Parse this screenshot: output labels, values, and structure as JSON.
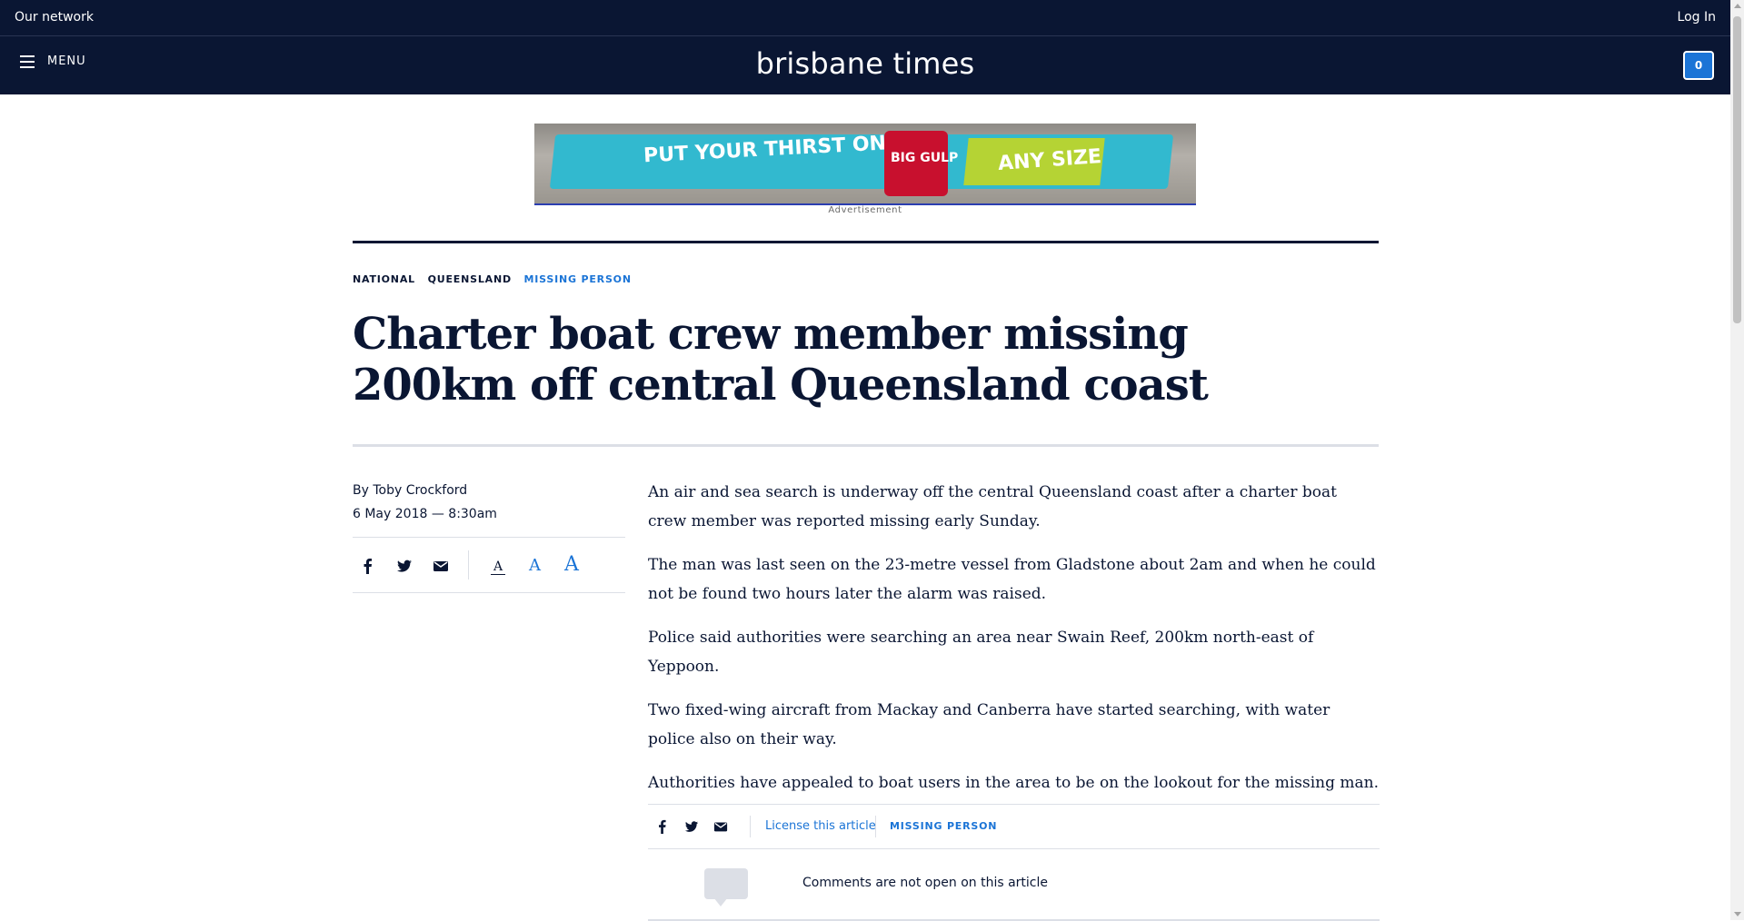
{
  "topbar": {
    "network_label": "Our network",
    "login_label": "Log In"
  },
  "header": {
    "menu_label": "MENU",
    "logo_text": "brisbane times",
    "cart_count": "0"
  },
  "ad": {
    "label": "Advertisement",
    "banner_text": "PUT YOUR THIRST ON ICE.",
    "cup_text": "BIG GULP",
    "green_text": "ANY SIZE"
  },
  "article": {
    "breadcrumbs": [
      "NATIONAL",
      "QUEENSLAND",
      "MISSING PERSON"
    ],
    "headline": "Charter boat crew member missing 200km off central Queensland coast",
    "byline": "By Toby Crockford",
    "date": "6 May 2018 — 8:30am",
    "paragraphs": [
      "An air and sea search is underway off the central Queensland coast after a charter boat crew member was reported missing early Sunday.",
      "The man was last seen on the 23-metre vessel from Gladstone about 2am and when he could not be found two hours later the alarm was raised.",
      "Police said authorities were searching an area near Swain Reef, 200km north-east of Yeppoon.",
      "Two fixed-wing aircraft from Mackay and Canberra have started searching, with water police also on their way.",
      "Authorities have appealed to boat users in the area to be on the lookout for the missing man."
    ],
    "font_size_label": "A"
  },
  "footer": {
    "license_label": "License this article",
    "tag_label": "MISSING PERSON",
    "comments_text": "Comments are not open on this article"
  },
  "colors": {
    "navy": "#0a1633",
    "accent_blue": "#1b74d6",
    "rule_gray": "#dcdfe6"
  },
  "icons": [
    "menu-icon",
    "facebook-icon",
    "twitter-icon",
    "email-icon",
    "comment-bubble-icon"
  ]
}
